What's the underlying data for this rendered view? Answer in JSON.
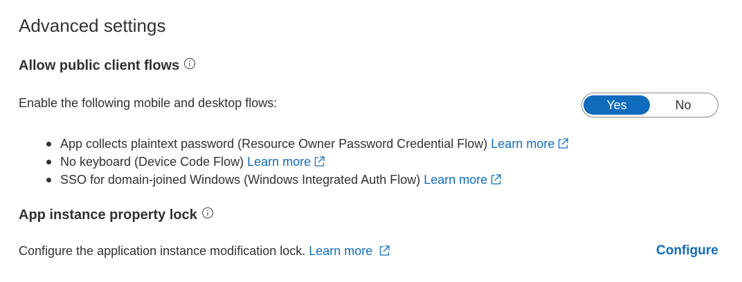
{
  "page": {
    "title": "Advanced settings"
  },
  "public_client_flows": {
    "heading": "Allow public client flows",
    "description": "Enable the following mobile and desktop flows:",
    "toggle": {
      "yes_label": "Yes",
      "no_label": "No",
      "selected": "Yes"
    },
    "items": [
      {
        "text": "App collects plaintext password (Resource Owner Password Credential Flow)",
        "link": "Learn more"
      },
      {
        "text": "No keyboard (Device Code Flow)",
        "link": "Learn more"
      },
      {
        "text": "SSO for domain-joined Windows (Windows Integrated Auth Flow)",
        "link": "Learn more"
      }
    ]
  },
  "instance_lock": {
    "heading": "App instance property lock",
    "description": "Configure the application instance modification lock.",
    "link": "Learn more",
    "configure_label": "Configure"
  },
  "colors": {
    "accent": "#0f6cbd",
    "text": "#323130",
    "border": "#8a8886"
  },
  "icons": {
    "info": "info-icon",
    "external": "external-link-icon"
  }
}
